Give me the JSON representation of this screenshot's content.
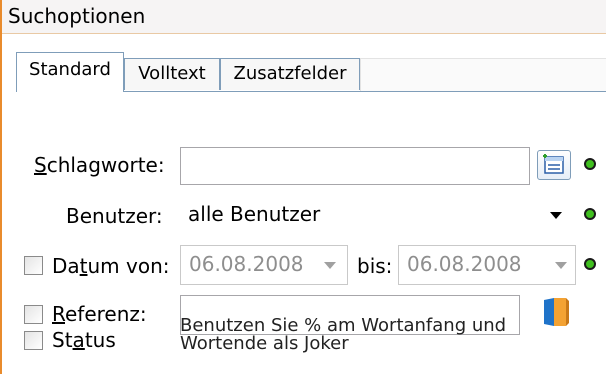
{
  "panel": {
    "title": "Suchoptionen"
  },
  "tabs": [
    {
      "label": "Standard",
      "active": true
    },
    {
      "label": "Volltext",
      "active": false
    },
    {
      "label": "Zusatzfelder",
      "active": false
    }
  ],
  "form": {
    "schlagworte": {
      "label_mnemonic": "S",
      "label_rest": "chlagworte:",
      "value": ""
    },
    "benutzer": {
      "label": "Benutzer:",
      "value": "alle Benutzer"
    },
    "datum": {
      "label_pre": "Da",
      "label_mnemonic": "t",
      "label_post": "um von:",
      "checked": false,
      "from_value": "06.08.2008",
      "bis_label": "bis:",
      "to_value": "06.08.2008"
    },
    "referenz": {
      "label_mnemonic": "R",
      "label_rest": "eferenz:",
      "checked": false,
      "value": ""
    },
    "status": {
      "label_pre": "St",
      "label_mnemonic": "a",
      "label_post": "tus",
      "checked": false
    },
    "hint_line1": "Benutzen Sie % am Wortanfang und",
    "hint_line2": "Wortende als Joker"
  },
  "icons": {
    "schlagworte_picker": "list-picker-icon",
    "referenz_picker": "folder-icon",
    "status_dots": "green-status-dot-icon"
  },
  "colors": {
    "accent": "#e98b2c",
    "status_dot": "#3fbf1f",
    "disabled_text": "#8e8e8e"
  }
}
